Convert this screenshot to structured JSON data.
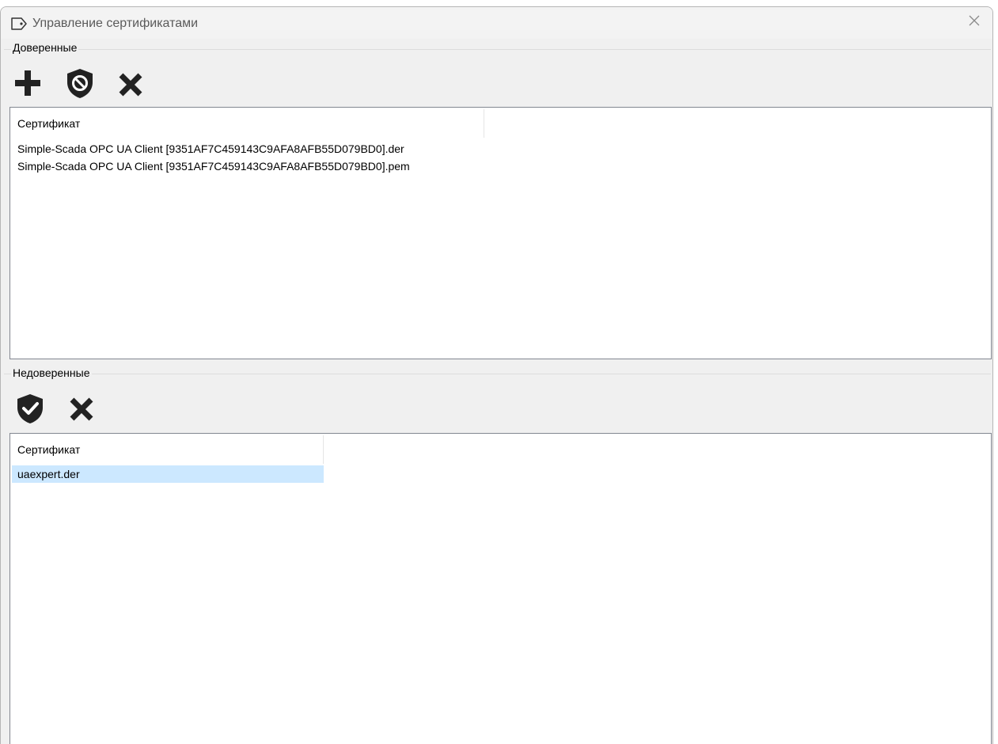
{
  "window": {
    "title": "Управление сертификатами"
  },
  "trusted": {
    "group_label": "Доверенные",
    "toolbar": [
      "add-icon",
      "block-shield-icon",
      "delete-icon"
    ],
    "column_header": "Сертификат",
    "rows": [
      "Simple-Scada OPC UA Client [9351AF7C459143C9AFA8AFB55D079BD0].der",
      "Simple-Scada OPC UA Client [9351AF7C459143C9AFA8AFB55D079BD0].pem"
    ]
  },
  "untrusted": {
    "group_label": "Недоверенные",
    "toolbar": [
      "trust-shield-icon",
      "delete-icon"
    ],
    "column_header": "Сертификат",
    "rows": [
      "uaexpert.der"
    ],
    "selected_row": 0
  },
  "colors": {
    "selection": "#cce8ff",
    "icon": "#222222"
  }
}
